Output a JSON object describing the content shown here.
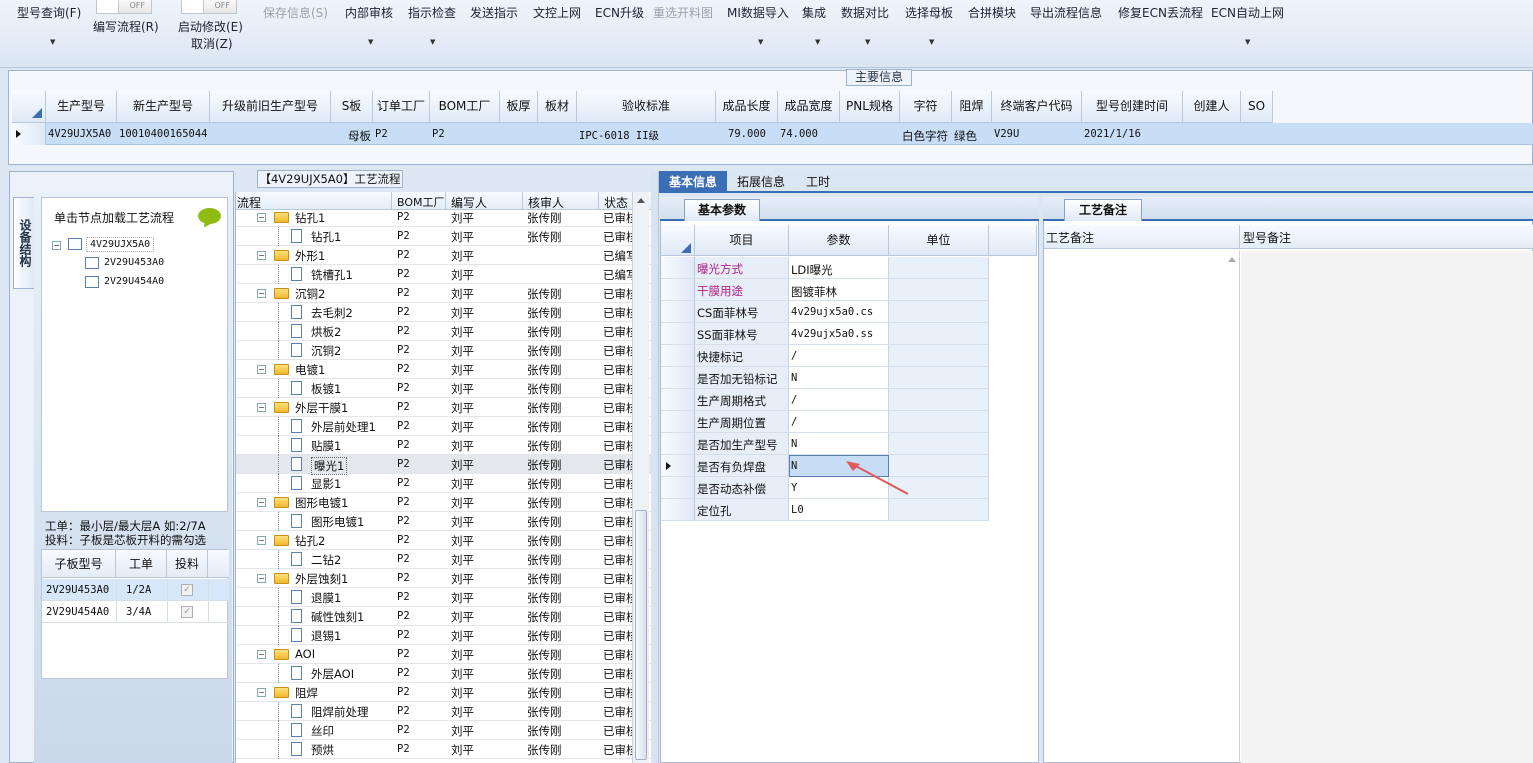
{
  "toolbar": {
    "items": [
      {
        "label": "型号查询(F)",
        "disabled": false,
        "caret": true
      },
      {
        "label": "编写流程(R)",
        "disabled": false,
        "caret": false,
        "toggle": "OFF"
      },
      {
        "label": "启动修改(E)",
        "disabled": false,
        "caret": false,
        "toggle": "OFF",
        "sub": "取消(Z)"
      },
      {
        "label": "保存信息(S)",
        "disabled": true,
        "caret": false
      },
      {
        "label": "内部审核",
        "disabled": false,
        "caret": true
      },
      {
        "label": "指示检查",
        "disabled": false,
        "caret": true
      },
      {
        "label": "发送指示",
        "disabled": false,
        "caret": false
      },
      {
        "label": "文控上网",
        "disabled": false,
        "caret": false
      },
      {
        "label": "ECN升级",
        "disabled": false,
        "caret": false
      },
      {
        "label": "重选开料图",
        "disabled": true,
        "caret": false
      },
      {
        "label": "MI数据导入",
        "disabled": false,
        "caret": true
      },
      {
        "label": "集成",
        "disabled": false,
        "caret": true
      },
      {
        "label": "数据对比",
        "disabled": false,
        "caret": true
      },
      {
        "label": "选择母板",
        "disabled": false,
        "caret": true
      },
      {
        "label": "合拼模块",
        "disabled": false,
        "caret": false
      },
      {
        "label": "导出流程信息",
        "disabled": false,
        "caret": false
      },
      {
        "label": "修复ECN丢流程",
        "disabled": false,
        "caret": false
      },
      {
        "label": "ECN自动上网",
        "disabled": false,
        "caret": true
      }
    ]
  },
  "main_info": {
    "title": "主要信息",
    "columns": [
      "生产型号",
      "新生产型号",
      "升级前旧生产型号",
      "S板",
      "订单工厂",
      "BOM工厂",
      "板厚",
      "板材",
      "验收标准",
      "成品长度",
      "成品宽度",
      "PNL规格",
      "字符",
      "阻焊",
      "终端客户代码",
      "型号创建时间",
      "创建人",
      "SO"
    ],
    "row": [
      "4V29UJX5A0",
      "10010400165044",
      "",
      "母板",
      "P2",
      "P2",
      "",
      "",
      "IPC-6018 II级",
      "79.000",
      "74.000",
      "",
      "白色字符",
      "绿色",
      "V29U",
      "2021/1/16",
      "",
      ""
    ]
  },
  "flow_panel": {
    "title": "【4V29UJX5A0】工艺流程"
  },
  "side_tab": "设备结构",
  "tree_panel": {
    "hint": "单击节点加载工艺流程",
    "root": "4V29UJX5A0",
    "children": [
      "2V29U453A0",
      "2V29U454A0"
    ],
    "note1": "工单：最小层/最大层A 如:2/7A",
    "note2": "投料：子板是芯板开料的需勾选"
  },
  "sub_table": {
    "columns": [
      "子板型号",
      "工单",
      "投料"
    ],
    "rows": [
      {
        "model": "2V29U453A0",
        "order": "1/2A",
        "checked": true
      },
      {
        "model": "2V29U454A0",
        "order": "3/4A",
        "checked": true
      }
    ]
  },
  "flow_table": {
    "columns": [
      "流程",
      "BOM工厂",
      "编写人",
      "核审人",
      "状态"
    ],
    "rows": [
      {
        "name": "钻孔1",
        "lvl": 0,
        "bom": "P2",
        "writer": "刘平",
        "reviewer": "张传刚",
        "status": "已审核"
      },
      {
        "name": "钻孔1",
        "lvl": 1,
        "bom": "P2",
        "writer": "刘平",
        "reviewer": "张传刚",
        "status": "已审核"
      },
      {
        "name": "外形1",
        "lvl": 0,
        "bom": "P2",
        "writer": "刘平",
        "reviewer": "",
        "status": "已编写"
      },
      {
        "name": "铣槽孔1",
        "lvl": 1,
        "bom": "P2",
        "writer": "刘平",
        "reviewer": "",
        "status": "已编写"
      },
      {
        "name": "沉铜2",
        "lvl": 0,
        "bom": "P2",
        "writer": "刘平",
        "reviewer": "张传刚",
        "status": "已审核"
      },
      {
        "name": "去毛刺2",
        "lvl": 1,
        "bom": "P2",
        "writer": "刘平",
        "reviewer": "张传刚",
        "status": "已审核"
      },
      {
        "name": "烘板2",
        "lvl": 1,
        "bom": "P2",
        "writer": "刘平",
        "reviewer": "张传刚",
        "status": "已审核"
      },
      {
        "name": "沉铜2",
        "lvl": 1,
        "bom": "P2",
        "writer": "刘平",
        "reviewer": "张传刚",
        "status": "已审核"
      },
      {
        "name": "电镀1",
        "lvl": 0,
        "bom": "P2",
        "writer": "刘平",
        "reviewer": "张传刚",
        "status": "已审核"
      },
      {
        "name": "板镀1",
        "lvl": 1,
        "bom": "P2",
        "writer": "刘平",
        "reviewer": "张传刚",
        "status": "已审核"
      },
      {
        "name": "外层干膜1",
        "lvl": 0,
        "bom": "P2",
        "writer": "刘平",
        "reviewer": "张传刚",
        "status": "已审核"
      },
      {
        "name": "外层前处理1",
        "lvl": 1,
        "bom": "P2",
        "writer": "刘平",
        "reviewer": "张传刚",
        "status": "已审核"
      },
      {
        "name": "贴膜1",
        "lvl": 1,
        "bom": "P2",
        "writer": "刘平",
        "reviewer": "张传刚",
        "status": "已审核"
      },
      {
        "name": "曝光1",
        "lvl": 1,
        "bom": "P2",
        "writer": "刘平",
        "reviewer": "张传刚",
        "status": "已审核",
        "selected": true
      },
      {
        "name": "显影1",
        "lvl": 1,
        "bom": "P2",
        "writer": "刘平",
        "reviewer": "张传刚",
        "status": "已审核"
      },
      {
        "name": "图形电镀1",
        "lvl": 0,
        "bom": "P2",
        "writer": "刘平",
        "reviewer": "张传刚",
        "status": "已审核"
      },
      {
        "name": "图形电镀1",
        "lvl": 1,
        "bom": "P2",
        "writer": "刘平",
        "reviewer": "张传刚",
        "status": "已审核"
      },
      {
        "name": "钻孔2",
        "lvl": 0,
        "bom": "P2",
        "writer": "刘平",
        "reviewer": "张传刚",
        "status": "已审核"
      },
      {
        "name": "二钻2",
        "lvl": 1,
        "bom": "P2",
        "writer": "刘平",
        "reviewer": "张传刚",
        "status": "已审核"
      },
      {
        "name": "外层蚀刻1",
        "lvl": 0,
        "bom": "P2",
        "writer": "刘平",
        "reviewer": "张传刚",
        "status": "已审核"
      },
      {
        "name": "退膜1",
        "lvl": 1,
        "bom": "P2",
        "writer": "刘平",
        "reviewer": "张传刚",
        "status": "已审核"
      },
      {
        "name": "碱性蚀刻1",
        "lvl": 1,
        "bom": "P2",
        "writer": "刘平",
        "reviewer": "张传刚",
        "status": "已审核"
      },
      {
        "name": "退锡1",
        "lvl": 1,
        "bom": "P2",
        "writer": "刘平",
        "reviewer": "张传刚",
        "status": "已审核"
      },
      {
        "name": "AOI",
        "lvl": 0,
        "bom": "P2",
        "writer": "刘平",
        "reviewer": "张传刚",
        "status": "已审核"
      },
      {
        "name": "外层AOI",
        "lvl": 1,
        "bom": "P2",
        "writer": "刘平",
        "reviewer": "张传刚",
        "status": "已审核"
      },
      {
        "name": "阻焊",
        "lvl": 0,
        "bom": "P2",
        "writer": "刘平",
        "reviewer": "张传刚",
        "status": "已审核"
      },
      {
        "name": "阻焊前处理",
        "lvl": 1,
        "bom": "P2",
        "writer": "刘平",
        "reviewer": "张传刚",
        "status": "已审核"
      },
      {
        "name": "丝印",
        "lvl": 1,
        "bom": "P2",
        "writer": "刘平",
        "reviewer": "张传刚",
        "status": "已审核"
      },
      {
        "name": "预烘",
        "lvl": 1,
        "bom": "P2",
        "writer": "刘平",
        "reviewer": "张传刚",
        "status": "已审核"
      }
    ]
  },
  "right_tabs": [
    "基本信息",
    "拓展信息",
    "工时"
  ],
  "basic_params": {
    "tab": "基本参数",
    "columns": [
      "项目",
      "参数",
      "单位"
    ],
    "rows": [
      {
        "item": "曝光方式",
        "value": "LDI曝光",
        "unit": "",
        "highlight": true
      },
      {
        "item": "干膜用途",
        "value": "图镀菲林",
        "unit": "",
        "highlight": true
      },
      {
        "item": "CS面菲林号",
        "value": "4v29ujx5a0.cs",
        "unit": ""
      },
      {
        "item": "SS面菲林号",
        "value": "4v29ujx5a0.ss",
        "unit": ""
      },
      {
        "item": "快捷标记",
        "value": "/",
        "unit": ""
      },
      {
        "item": "是否加无铅标记",
        "value": "N",
        "unit": ""
      },
      {
        "item": "生产周期格式",
        "value": "/",
        "unit": ""
      },
      {
        "item": "生产周期位置",
        "value": "/",
        "unit": ""
      },
      {
        "item": "是否加生产型号",
        "value": "N",
        "unit": ""
      },
      {
        "item": "是否有负焊盘",
        "value": "N",
        "unit": "",
        "current": true
      },
      {
        "item": "是否动态补偿",
        "value": "Y",
        "unit": ""
      },
      {
        "item": "定位孔",
        "value": "L0",
        "unit": ""
      }
    ]
  },
  "process_notes": {
    "tab": "工艺备注",
    "col1": "工艺备注",
    "col2": "型号备注"
  },
  "colors": {
    "accent": "#3b6fb5",
    "highlight_text": "#b0208a",
    "selected_row": "#cfe3fb",
    "arrow": "#e05a5a"
  }
}
